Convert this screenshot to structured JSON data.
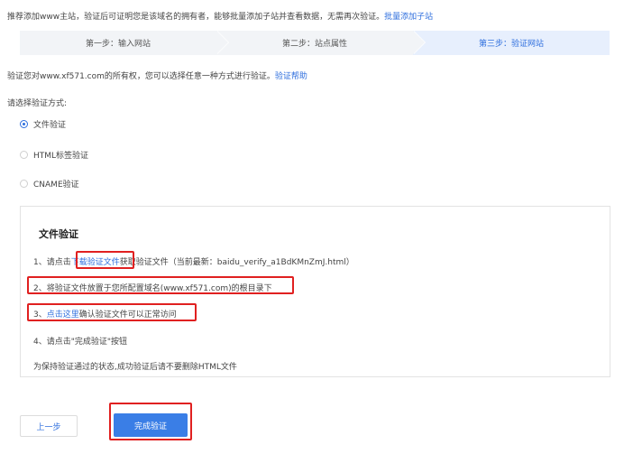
{
  "intro": {
    "text": "推荐添加www主站，验证后可证明您是该域名的拥有者，能够批量添加子站并查看数据，无需再次验证。",
    "link": "批量添加子站"
  },
  "steps": [
    {
      "label": "第一步：输入网站"
    },
    {
      "label": "第二步：站点属性"
    },
    {
      "label": "第三步：验证网站"
    }
  ],
  "verify": {
    "desc": "验证您对www.xf571.com的所有权，您可以选择任意一种方式进行验证。",
    "help_link": "验证帮助",
    "choose_label": "请选择验证方式:"
  },
  "methods": [
    {
      "label": "文件验证",
      "checked": true
    },
    {
      "label": "HTML标签验证",
      "checked": false
    },
    {
      "label": "CNAME验证",
      "checked": false
    }
  ],
  "panel": {
    "title": "文件验证",
    "step1_prefix": "1、请点击",
    "step1_link": "下载验证文件",
    "step1_suffix": "获取验证文件（当前最新：baidu_verify_a1BdKMnZmJ.html）",
    "step2": "2、将验证文件放置于您所配置域名(www.xf571.com)的根目录下",
    "step3_prefix": "3、",
    "step3_link": "点击这里",
    "step3_suffix": "确认验证文件可以正常访问",
    "step4": "4、请点击\"完成验证\"按钮",
    "note": "为保持验证通过的状态,成功验证后请不要删除HTML文件"
  },
  "buttons": {
    "prev": "上一步",
    "done": "完成验证"
  },
  "colors": {
    "accent": "#2f6fde",
    "highlight": "#e02020",
    "primary_button": "#3a7ee6"
  }
}
